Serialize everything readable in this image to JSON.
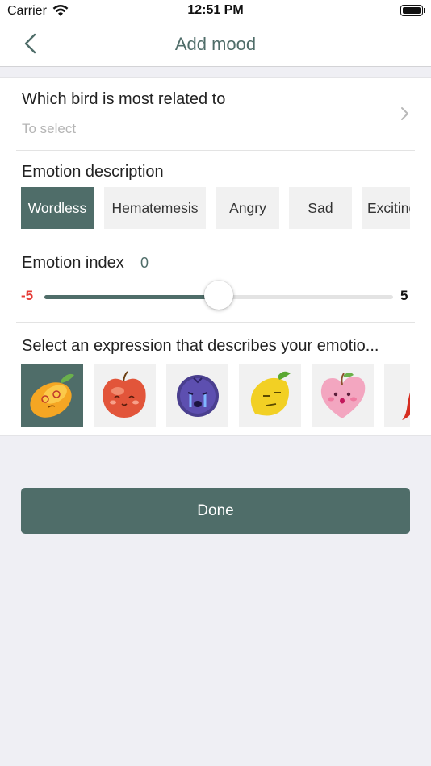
{
  "status_bar": {
    "carrier": "Carrier",
    "time": "12:51 PM"
  },
  "nav": {
    "title": "Add mood"
  },
  "bird": {
    "title": "Which bird is most related to",
    "placeholder": "To select"
  },
  "emotion_description": {
    "title": "Emotion description",
    "tags": [
      "Wordless",
      "Hematemesis",
      "Angry",
      "Sad",
      "Exciting"
    ],
    "selected": "Wordless"
  },
  "emotion_index": {
    "title": "Emotion index",
    "value": "0",
    "min": "-5",
    "max": "5",
    "level": 0
  },
  "expression": {
    "title": "Select an expression that describes your emotio...",
    "items": [
      "mango-face-icon",
      "apple-face-icon",
      "blueberry-face-icon",
      "lemon-face-icon",
      "peach-heart-face-icon",
      "chili-face-icon"
    ],
    "selected_index": 0
  },
  "done_button": {
    "label": "Done"
  },
  "colors": {
    "accent": "#4f6d69",
    "negative": "#e53935",
    "tag_bg": "#f1f1f1"
  }
}
